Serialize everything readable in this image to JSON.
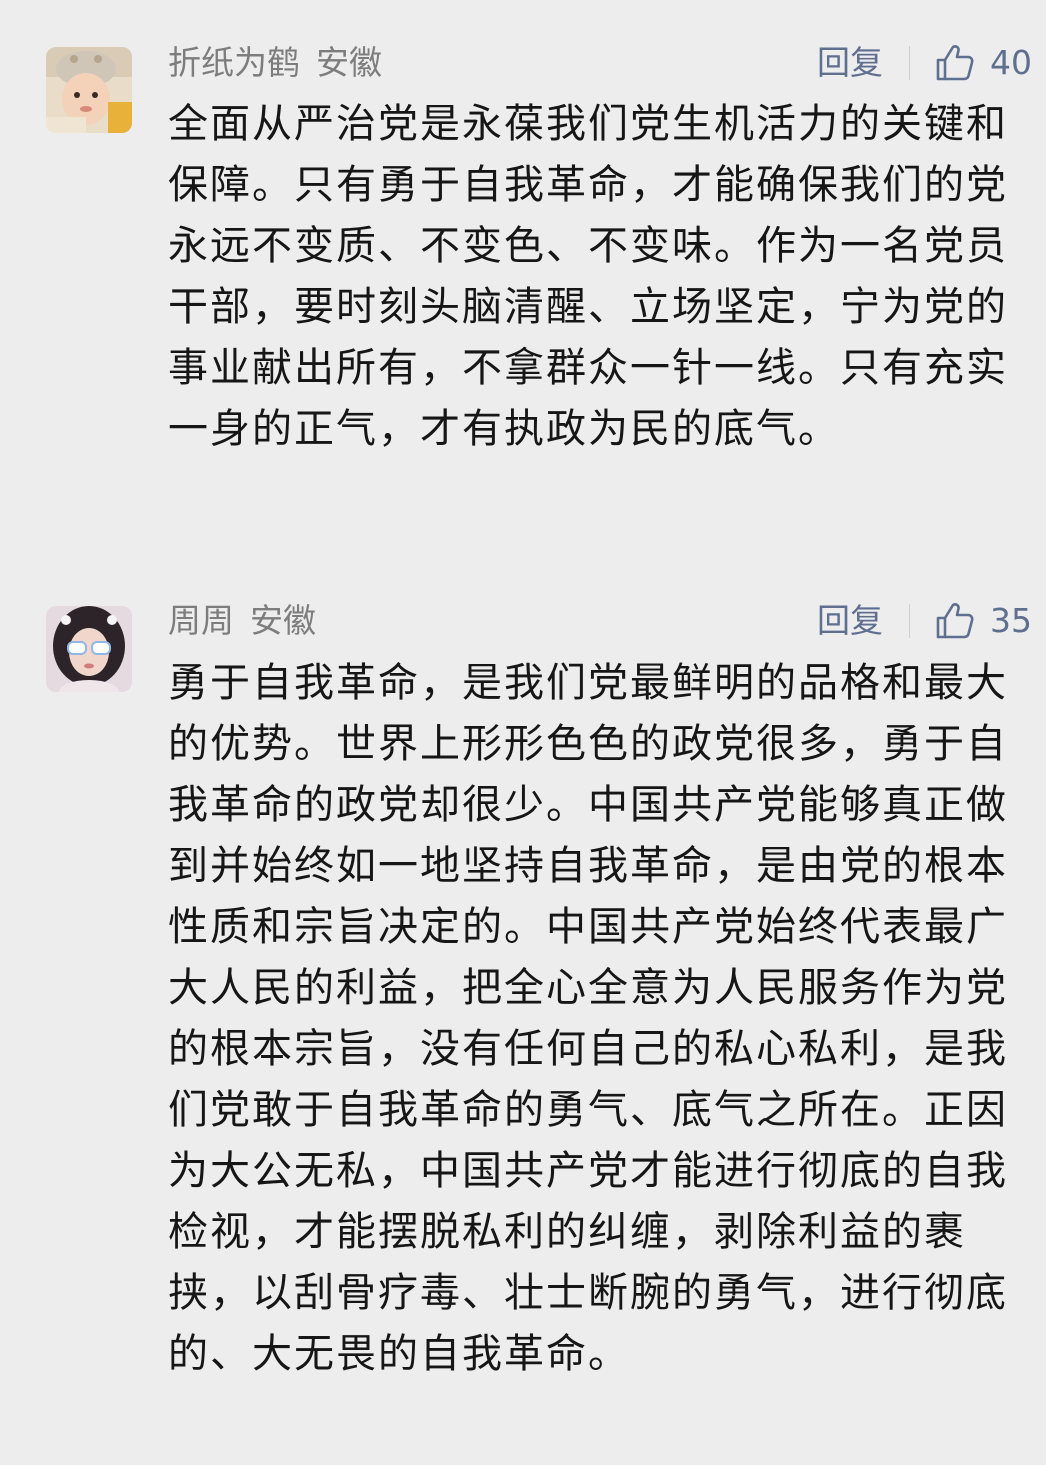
{
  "comments": [
    {
      "author": "折纸为鹤",
      "location": "安徽",
      "reply_label": "回复",
      "likes": "40",
      "text": "全面从严治党是永葆我们党生机活力的关键和保障。只有勇于自我革命，才能确保我们的党永远不变质、不变色、不变味。作为一名党员干部，要时刻头脑清醒、立场坚定，宁为党的事业献出所有，不拿群众一针一线。只有充实一身的正气，才有执政为民的底气。"
    },
    {
      "author": "周周",
      "location": "安徽",
      "reply_label": "回复",
      "likes": "35",
      "text": "勇于自我革命，是我们党最鲜明的品格和最大的优势。世界上形形色色的政党很多，勇于自我革命的政党却很少。中国共产党能够真正做到并始终如一地坚持自我革命，是由党的根本性质和宗旨决定的。中国共产党始终代表最广大人民的利益，把全心全意为人民服务作为党的根本宗旨，没有任何自己的私心私利，是我们党敢于自我革命的勇气、底气之所在。正因为大公无私，中国共产党才能进行彻底的自我检视，才能摆脱私利的纠缠，剥除利益的裹挟，以刮骨疗毒、壮士断腕的勇气，进行彻底的、大无畏的自我革命。"
    }
  ],
  "icons": {
    "like": "thumbs-up-icon"
  },
  "colors": {
    "background": "#ededed",
    "meta_text": "#7d7d7d",
    "action_text": "#5f6f90",
    "body_text": "#161616"
  }
}
